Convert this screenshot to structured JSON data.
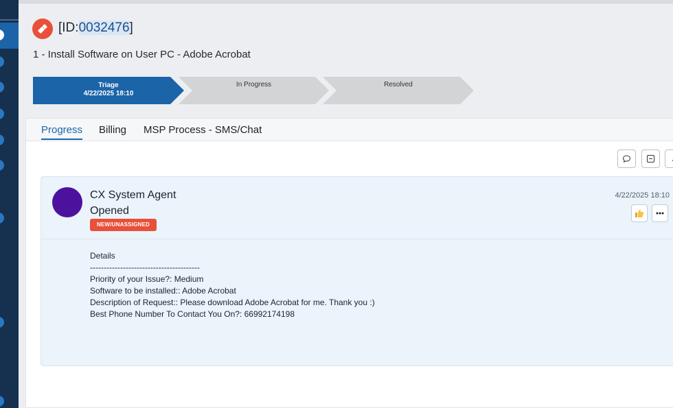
{
  "ticket": {
    "id_prefix": "[ID:",
    "id_number": "0032476",
    "id_suffix": "]",
    "title": "1 - Install Software on User PC - Adobe Acrobat"
  },
  "stages": [
    {
      "label": "Triage",
      "date": "4/22/2025 18:10",
      "active": true
    },
    {
      "label": "In Progress",
      "active": false
    },
    {
      "label": "Resolved",
      "active": false
    }
  ],
  "tabs": [
    {
      "label": "Progress",
      "active": true
    },
    {
      "label": "Billing",
      "active": false
    },
    {
      "label": "MSP Process - SMS/Chat",
      "active": false
    }
  ],
  "toolbar_icons": [
    "comment-icon",
    "collapse-icon",
    "sort-down-icon"
  ],
  "activity": {
    "agent": "CX System Agent",
    "action": "Opened",
    "status_badge": "NEW/UNASSIGNED",
    "timestamp": "4/22/2025 18:10",
    "details_heading": "Details",
    "separator": "----------------------------------------",
    "lines": [
      "Priority of your Issue?: Medium",
      "Software to be installed:: Adobe Acrobat",
      "Description of Request:: Please download Adobe Acrobat for me. Thank you :)",
      "Best Phone Number To Contact You On?: 66992174198"
    ]
  },
  "colors": {
    "brand": "#1b64a8",
    "accent": "#e8503a",
    "avatar": "#4c129e",
    "rail": "#16304f"
  }
}
